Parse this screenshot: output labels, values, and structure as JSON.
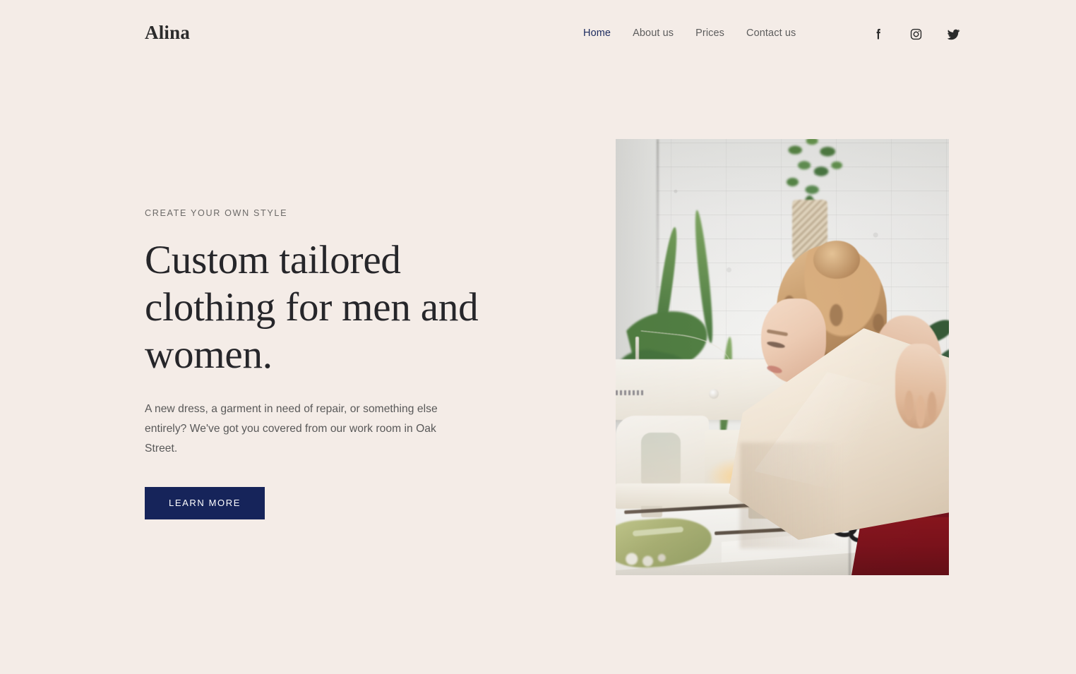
{
  "site": {
    "brand": "Alina",
    "background_color": "#f4ece7",
    "accent_color": "#16245a",
    "heading_color": "#26262a",
    "muted_text_color": "#585858"
  },
  "nav": {
    "items": [
      {
        "label": "Home",
        "active": true
      },
      {
        "label": "About us",
        "active": false
      },
      {
        "label": "Prices",
        "active": false
      },
      {
        "label": "Contact us",
        "active": false
      }
    ]
  },
  "social": {
    "items": [
      {
        "name": "facebook-icon",
        "label": "Facebook"
      },
      {
        "name": "instagram-icon",
        "label": "Instagram"
      },
      {
        "name": "twitter-icon",
        "label": "Twitter"
      }
    ]
  },
  "hero": {
    "eyebrow": "CREATE YOUR OWN STYLE",
    "headline": "Custom tailored clothing for men and women.",
    "paragraph": "A new dress, a garment in need of repair, or something else entirely? We've got you covered from our work room in Oak Street.",
    "cta_label": "LEARN MORE",
    "image_alt": "Woman in a red dress holding cream fabric beside a white sewing machine in a bright workroom with plants and a white brick wall"
  }
}
